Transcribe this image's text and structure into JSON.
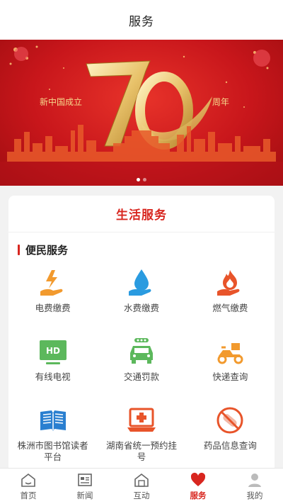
{
  "header": {
    "title": "服务"
  },
  "banner": {
    "left_text": "新中国成立",
    "right_text": "周年",
    "slide_count": 2,
    "active_slide": 1
  },
  "card": {
    "title": "生活服务",
    "section": {
      "title": "便民服务",
      "items": [
        {
          "label": "电费缴费",
          "icon": "electricity-icon"
        },
        {
          "label": "水费缴费",
          "icon": "water-drop-icon"
        },
        {
          "label": "燃气缴费",
          "icon": "gas-flame-icon"
        },
        {
          "label": "有线电视",
          "icon": "hd-tv-icon"
        },
        {
          "label": "交通罚款",
          "icon": "traffic-car-icon"
        },
        {
          "label": "快递查询",
          "icon": "delivery-scooter-icon"
        },
        {
          "label": "株洲市图书馆读者平台",
          "icon": "book-icon"
        },
        {
          "label": "湖南省统一预约挂号",
          "icon": "medical-laptop-icon"
        },
        {
          "label": "药品信息查询",
          "icon": "pill-icon"
        }
      ]
    }
  },
  "tabbar": {
    "tabs": [
      {
        "label": "首页",
        "icon": "home-icon"
      },
      {
        "label": "新闻",
        "icon": "news-icon"
      },
      {
        "label": "互动",
        "icon": "interact-icon"
      },
      {
        "label": "服务",
        "icon": "heart-icon",
        "active": true
      },
      {
        "label": "我的",
        "icon": "user-icon"
      }
    ]
  },
  "colors": {
    "accent": "#d8261f",
    "orange": "#f29a2e",
    "blue": "#2a9be0",
    "green": "#5cb85c"
  }
}
